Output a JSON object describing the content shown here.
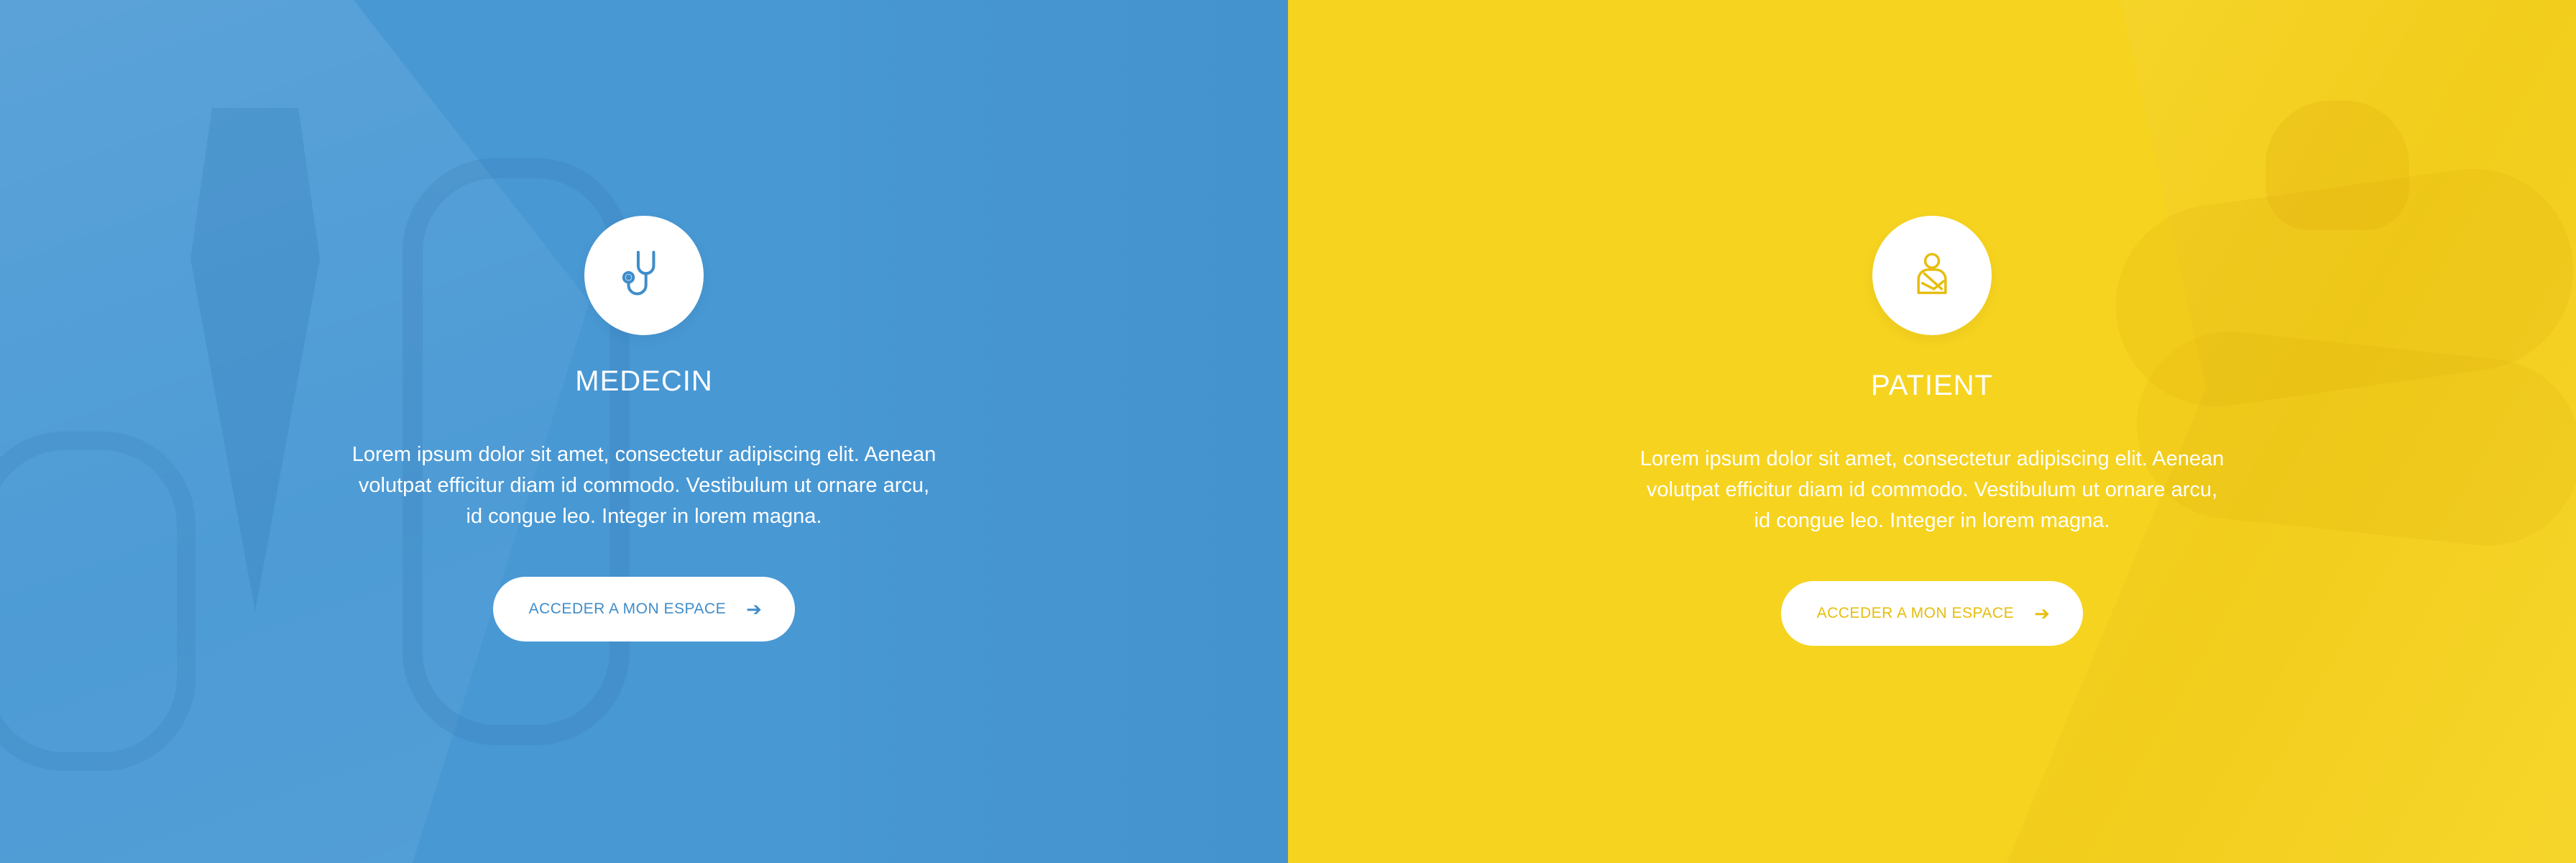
{
  "panels": {
    "medecin": {
      "title": "MEDECIN",
      "description": "Lorem ipsum dolor sit amet, consectetur adipiscing elit. Aenean volutpat efficitur diam id commodo. Vestibulum ut ornare arcu, id congue leo. Integer in lorem magna.",
      "button_label": "ACCEDER A MON ESPACE",
      "button_icon": "arrow-right-icon",
      "icon": "stethoscope-icon",
      "background_color": "#4898d4",
      "accent_color": "#3f8dca"
    },
    "patient": {
      "title": "PATIENT",
      "description": "Lorem ipsum dolor sit amet, consectetur adipiscing elit. Aenean volutpat efficitur diam id commodo. Vestibulum ut ornare arcu, id congue leo. Integer in lorem magna.",
      "button_label": "ACCEDER A MON ESPACE",
      "button_icon": "arrow-right-icon",
      "icon": "patient-arm-sling-icon",
      "background_color": "#f6d31f",
      "accent_color": "#e6bd0d"
    }
  }
}
